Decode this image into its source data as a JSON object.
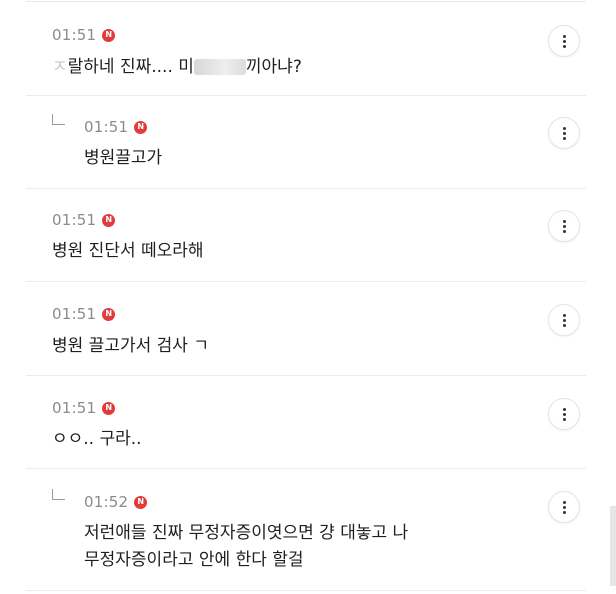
{
  "comments": [
    {
      "time": "01:51",
      "badge": "N",
      "text_start": "ㅈ",
      "text_mid": "랄하네 진짜.... 미",
      "text_mid2": "끼아냐?"
    },
    {
      "time": "01:51",
      "badge": "N",
      "text": "병원끌고가"
    },
    {
      "time": "01:51",
      "badge": "N",
      "text": "병원 진단서 떼오라해"
    },
    {
      "time": "01:51",
      "badge": "N",
      "text": "병원 끌고가서 검사 ㄱ"
    },
    {
      "time": "01:51",
      "badge": "N",
      "text": "ㅇㅇ.. 구라.."
    },
    {
      "time": "01:52",
      "badge": "N",
      "text_line1": "저런애들 진짜 무정자증이엿으면 걍 대놓고 나",
      "text_line2": "무정자증이라고 안에 한다 할걸"
    }
  ]
}
